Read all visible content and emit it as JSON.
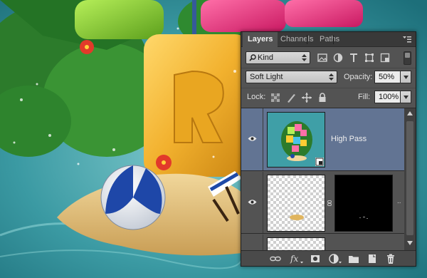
{
  "panel": {
    "tabs": [
      {
        "label": "Layers",
        "active": true
      },
      {
        "label": "Channels",
        "active": false
      },
      {
        "label": "Paths",
        "active": false
      }
    ],
    "filter": {
      "kind_label": "Kind"
    },
    "blend": {
      "mode": "Soft Light",
      "opacity_label": "Opacity:",
      "opacity_value": "50%"
    },
    "lock": {
      "label": "Lock:",
      "fill_label": "Fill:",
      "fill_value": "100%"
    },
    "layers": [
      {
        "name": "High Pass",
        "visible": true,
        "selected": true,
        "smart_object": true
      },
      {
        "name": "",
        "visible": true,
        "selected": false,
        "has_mask": true
      },
      {
        "name": "",
        "visible": false,
        "selected": false
      }
    ],
    "bottom_icons": [
      "link-layers-icon",
      "fx-icon",
      "add-mask-icon",
      "adjustment-layer-icon",
      "new-group-icon",
      "new-layer-icon",
      "delete-layer-icon"
    ]
  },
  "colors": {
    "panel_bg": "#535353",
    "tab_bar_bg": "#393939",
    "selected_layer": "#627493",
    "water": "#2f8a94"
  }
}
